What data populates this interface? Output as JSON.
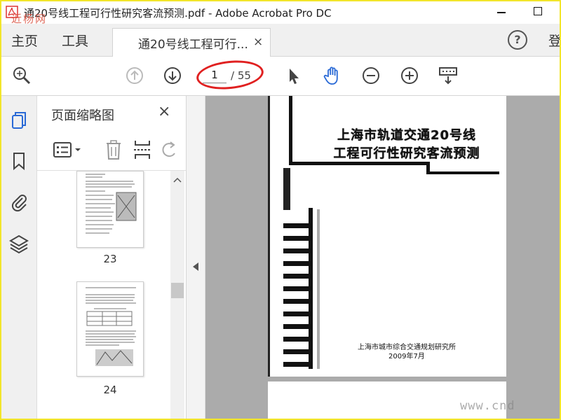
{
  "window": {
    "title": "通20号线工程可行性研究客流预测.pdf - Adobe Acrobat Pro DC",
    "logo_watermark": "近杨网"
  },
  "menu": {
    "home": "主页",
    "tools": "工具",
    "doc_tab": "通20号线工程可行...",
    "doc_tab_close": "×",
    "help": "?",
    "login": "登"
  },
  "toolbar": {
    "current_page": "1",
    "total_pages": "/ 55",
    "icons": [
      "search-icon",
      "previous-page-icon",
      "next-page-icon",
      "select-arrow-icon",
      "hand-tool-icon",
      "zoom-out-icon",
      "zoom-in-icon",
      "keyboard-download-icon"
    ]
  },
  "panel": {
    "title": "页面缩略图",
    "close": "×",
    "thumbnails": [
      {
        "label": "23"
      },
      {
        "label": "24"
      }
    ]
  },
  "document": {
    "cover_title_line1": "上海市轨道交通20号线",
    "cover_title_line2": "工程可行性研究客流预测",
    "organization": "上海市城市综合交通规划研究所",
    "date": "2009年7月",
    "site_watermark": "www.cnd"
  },
  "colors": {
    "accent_blue": "#2a6ad6",
    "annotation_red": "#e02020",
    "frame_yellow": "#f2e52b",
    "doc_background": "#ababab"
  }
}
